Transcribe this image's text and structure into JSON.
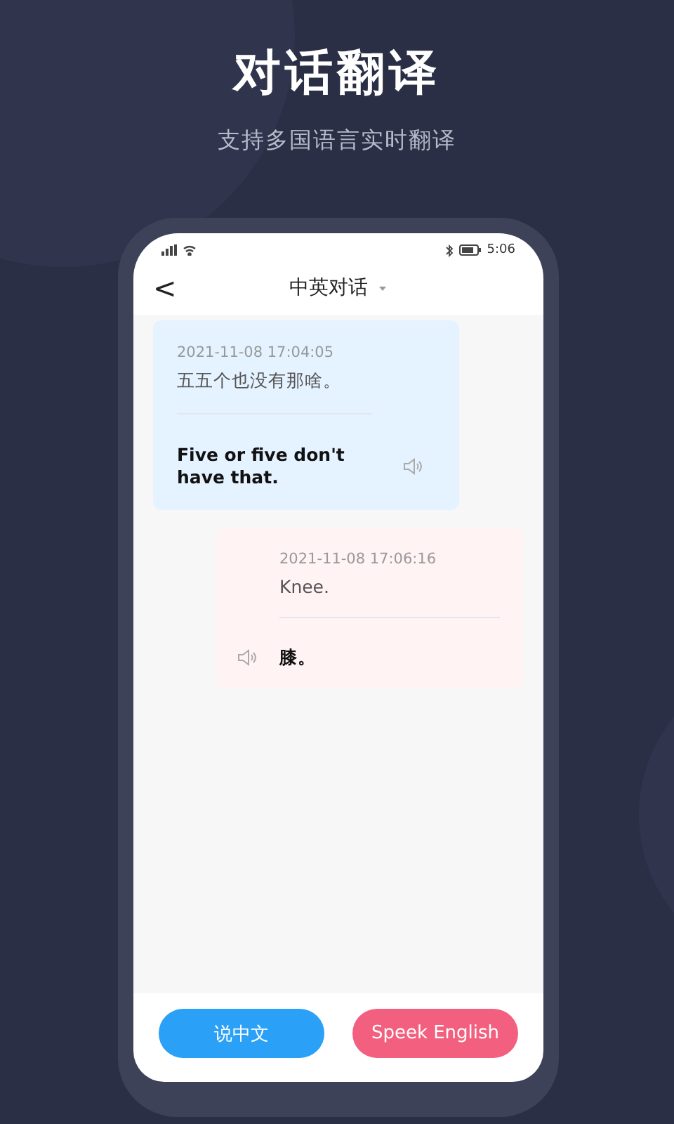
{
  "headline": "对话翻译",
  "subheadline": "支持多国语言实时翻译",
  "status_bar": {
    "time": "5:06"
  },
  "header": {
    "title": "中英对话",
    "back_label": "<"
  },
  "messages": [
    {
      "kind": "left",
      "time": "2021-11-08 17:04:05",
      "source": "五五个也没有那啥。",
      "translation": "Five or five don't have that."
    },
    {
      "kind": "right",
      "time": "2021-11-08 17:06:16",
      "source": "Knee.",
      "translation": "膝。"
    }
  ],
  "buttons": [
    {
      "label": "说中文",
      "color": "#2ba0f7"
    },
    {
      "label": "Speek English",
      "color": "#f3607f"
    }
  ]
}
